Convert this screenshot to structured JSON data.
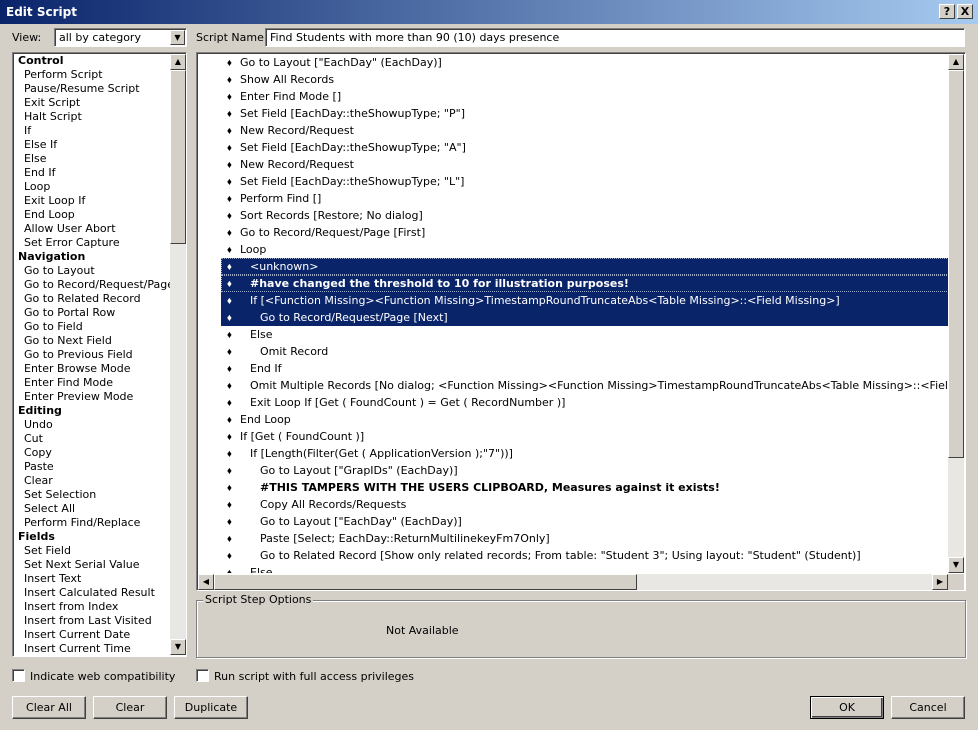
{
  "window": {
    "title": "Edit Script",
    "help_glyph": "?",
    "close_glyph": "X"
  },
  "view": {
    "label": "View:",
    "value": "all by category"
  },
  "script_name": {
    "label": "Script Name:",
    "value": "Find Students with more than 90 (10) days presence"
  },
  "step_categories": [
    {
      "name": "Control",
      "steps": [
        "Perform Script",
        "Pause/Resume Script",
        "Exit Script",
        "Halt Script",
        "If",
        "Else If",
        "Else",
        "End If",
        "Loop",
        "Exit Loop If",
        "End Loop",
        "Allow User Abort",
        "Set Error Capture"
      ]
    },
    {
      "name": "Navigation",
      "steps": [
        "Go to Layout",
        "Go to Record/Request/Page",
        "Go to Related Record",
        "Go to Portal Row",
        "Go to Field",
        "Go to Next Field",
        "Go to Previous Field",
        "Enter Browse Mode",
        "Enter Find Mode",
        "Enter Preview Mode"
      ]
    },
    {
      "name": "Editing",
      "steps": [
        "Undo",
        "Cut",
        "Copy",
        "Paste",
        "Clear",
        "Set Selection",
        "Select All",
        "Perform Find/Replace"
      ]
    },
    {
      "name": "Fields",
      "steps": [
        "Set Field",
        "Set Next Serial Value",
        "Insert Text",
        "Insert Calculated Result",
        "Insert from Index",
        "Insert from Last Visited",
        "Insert Current Date",
        "Insert Current Time"
      ]
    }
  ],
  "script_lines": [
    {
      "indent": 0,
      "text": "Go to Layout [\"EachDay\" (EachDay)]"
    },
    {
      "indent": 0,
      "text": "Show All Records"
    },
    {
      "indent": 0,
      "text": "Enter Find Mode []"
    },
    {
      "indent": 0,
      "text": "Set Field [EachDay::theShowupType; \"P\"]"
    },
    {
      "indent": 0,
      "text": "New Record/Request"
    },
    {
      "indent": 0,
      "text": "Set Field [EachDay::theShowupType; \"A\"]"
    },
    {
      "indent": 0,
      "text": "New Record/Request"
    },
    {
      "indent": 0,
      "text": "Set Field [EachDay::theShowupType; \"L\"]"
    },
    {
      "indent": 0,
      "text": "Perform Find []"
    },
    {
      "indent": 0,
      "text": "Sort Records [Restore; No dialog]"
    },
    {
      "indent": 0,
      "text": "Go to Record/Request/Page [First]"
    },
    {
      "indent": 0,
      "text": "Loop"
    },
    {
      "indent": 1,
      "text": "<unknown>",
      "selected": true,
      "dotted": true
    },
    {
      "indent": 1,
      "text": "#have changed the threshold to 10 for illustration purposes!",
      "selected": true,
      "bold": true,
      "dotted": true
    },
    {
      "indent": 1,
      "text": "If [<Function Missing><Function Missing>TimestampRoundTruncateAbs<Table Missing>::<Field Missing>]",
      "selected": true
    },
    {
      "indent": 2,
      "text": "Go to Record/Request/Page [Next]",
      "selected": true
    },
    {
      "indent": 1,
      "text": "Else"
    },
    {
      "indent": 2,
      "text": "Omit Record"
    },
    {
      "indent": 1,
      "text": "End If"
    },
    {
      "indent": 1,
      "text": "Omit Multiple Records [No dialog; <Function Missing><Function Missing>TimestampRoundTruncateAbs<Table Missing>::<Field Missing>]"
    },
    {
      "indent": 1,
      "text": "Exit Loop If [Get ( FoundCount )  =  Get ( RecordNumber )]"
    },
    {
      "indent": 0,
      "text": "End Loop"
    },
    {
      "indent": 0,
      "text": "If [Get ( FoundCount )]"
    },
    {
      "indent": 1,
      "text": "If [Length(Filter(Get ( ApplicationVersion );\"7\"))]"
    },
    {
      "indent": 2,
      "text": "Go to Layout [\"GrapIDs\" (EachDay)]"
    },
    {
      "indent": 2,
      "text": "#THIS TAMPERS WITH THE USERS CLIPBOARD, Measures against it exists!",
      "bold": true
    },
    {
      "indent": 2,
      "text": "Copy All Records/Requests"
    },
    {
      "indent": 2,
      "text": "Go to Layout [\"EachDay\" (EachDay)]"
    },
    {
      "indent": 2,
      "text": "Paste [Select; EachDay::ReturnMultilinekeyFm7Only]"
    },
    {
      "indent": 2,
      "text": "Go to Related Record [Show only related records; From table: \"Student 3\"; Using layout: \"Student\" (Student)]"
    },
    {
      "indent": 1,
      "text": "Else"
    }
  ],
  "options": {
    "legend": "Script Step Options",
    "status": "Not Available"
  },
  "checkboxes": {
    "web_compat": "Indicate web compatibility",
    "full_access": "Run script with full access privileges"
  },
  "buttons": {
    "clear_all": "Clear All",
    "clear": "Clear",
    "duplicate": "Duplicate",
    "ok": "OK",
    "cancel": "Cancel"
  },
  "colors": {
    "title_bar_start": "#0a246a",
    "title_bar_end": "#a6caf0",
    "selection": "#0a246a",
    "face": "#d4d0c8"
  }
}
